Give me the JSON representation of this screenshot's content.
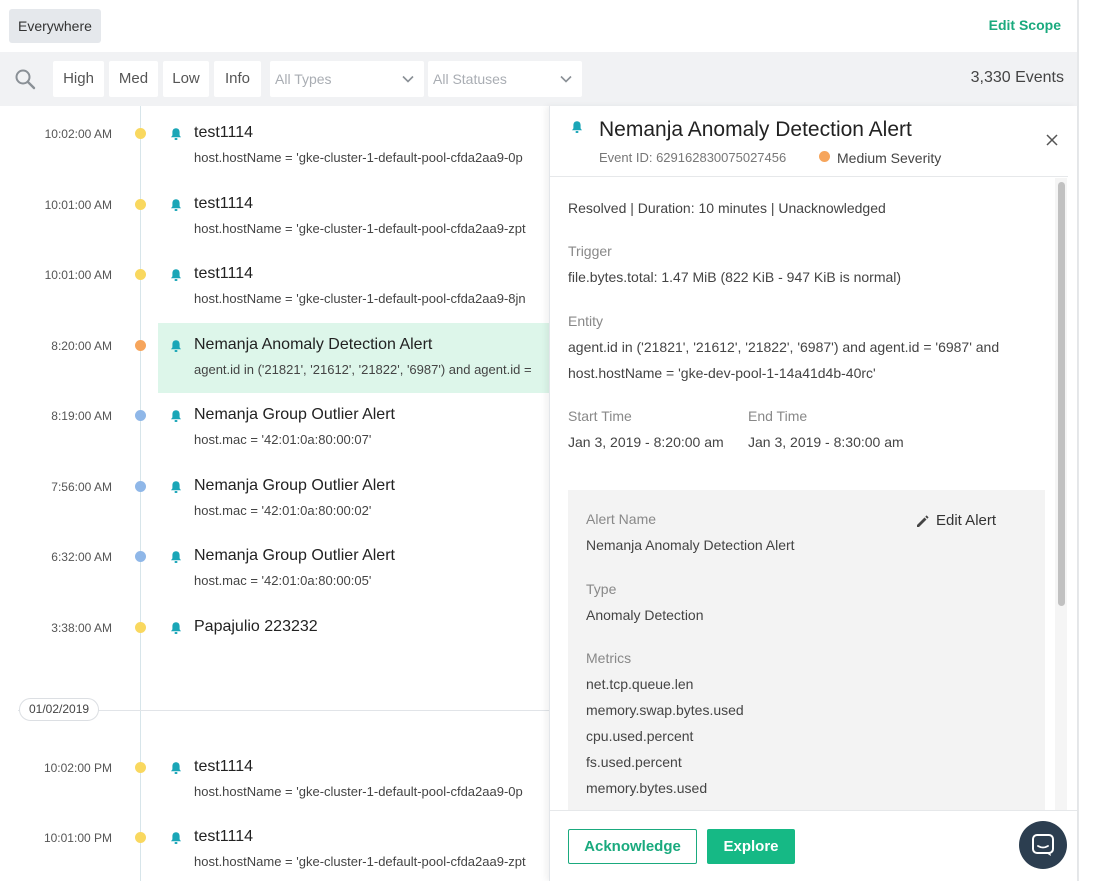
{
  "header": {
    "scope_label": "Everywhere",
    "edit_scope_label": "Edit Scope"
  },
  "filters": {
    "severity_buttons": [
      "High",
      "Med",
      "Low",
      "Info"
    ],
    "type_dropdown": "All Types",
    "status_dropdown": "All Statuses",
    "events_count": "3,330 Events"
  },
  "colors": {
    "accent": "#1aaa7e",
    "severity_low": "#f9d85f",
    "severity_medium": "#f6a55c",
    "severity_info": "#8fb7e8",
    "selected_row": "#ddf6ea",
    "bell": "#1aa6b7"
  },
  "timeline": {
    "events": [
      {
        "time": "10:02:00 AM",
        "severity": "low",
        "title": "test1114",
        "desc": "host.hostName = 'gke-cluster-1-default-pool-cfda2aa9-0p"
      },
      {
        "time": "10:01:00 AM",
        "severity": "low",
        "title": "test1114",
        "desc": "host.hostName = 'gke-cluster-1-default-pool-cfda2aa9-zpt"
      },
      {
        "time": "10:01:00 AM",
        "severity": "low",
        "title": "test1114",
        "desc": "host.hostName = 'gke-cluster-1-default-pool-cfda2aa9-8jn"
      },
      {
        "time": "8:20:00 AM",
        "severity": "medium",
        "title": "Nemanja Anomaly Detection Alert",
        "desc": "agent.id in ('21821', '21612', '21822', '6987') and agent.id =",
        "selected": true
      },
      {
        "time": "8:19:00 AM",
        "severity": "info",
        "title": "Nemanja Group Outlier Alert",
        "desc": "host.mac = '42:01:0a:80:00:07'"
      },
      {
        "time": "7:56:00 AM",
        "severity": "info",
        "title": "Nemanja Group Outlier Alert",
        "desc": "host.mac = '42:01:0a:80:00:02'"
      },
      {
        "time": "6:32:00 AM",
        "severity": "info",
        "title": "Nemanja Group Outlier Alert",
        "desc": "host.mac = '42:01:0a:80:00:05'"
      },
      {
        "time": "3:38:00 AM",
        "severity": "low",
        "title": "Papajulio 223232",
        "desc": ""
      }
    ],
    "date_separator": "01/02/2019",
    "events_after": [
      {
        "time": "10:02:00 PM",
        "severity": "low",
        "title": "test1114",
        "desc": "host.hostName = 'gke-cluster-1-default-pool-cfda2aa9-0p"
      },
      {
        "time": "10:01:00 PM",
        "severity": "low",
        "title": "test1114",
        "desc": "host.hostName = 'gke-cluster-1-default-pool-cfda2aa9-zpt"
      }
    ]
  },
  "detail": {
    "title": "Nemanja Anomaly Detection Alert",
    "event_id": "Event ID: 629162830075027456",
    "severity": "Medium Severity",
    "status_line": "Resolved | Duration: 10 minutes | Unacknowledged",
    "trigger_label": "Trigger",
    "trigger_value": "file.bytes.total: 1.47 MiB (822 KiB - 947 KiB is normal)",
    "entity_label": "Entity",
    "entity_line1": "agent.id in ('21821', '21612', '21822', '6987') and agent.id = '6987' and",
    "entity_line2": "host.hostName = 'gke-dev-pool-1-14a41d4b-40rc'",
    "start_label": "Start Time",
    "start_value": "Jan 3, 2019 - 8:20:00 am",
    "end_label": "End Time",
    "end_value": "Jan 3, 2019 - 8:30:00 am",
    "alert_name_label": "Alert Name",
    "alert_name_value": "Nemanja Anomaly Detection Alert",
    "edit_alert_label": "Edit Alert",
    "type_label": "Type",
    "type_value": "Anomaly Detection",
    "metrics_label": "Metrics",
    "metrics": [
      "net.tcp.queue.len",
      "memory.swap.bytes.used",
      "cpu.used.percent",
      "fs.used.percent",
      "memory.bytes.used"
    ],
    "acknowledge_label": "Acknowledge",
    "explore_label": "Explore"
  }
}
